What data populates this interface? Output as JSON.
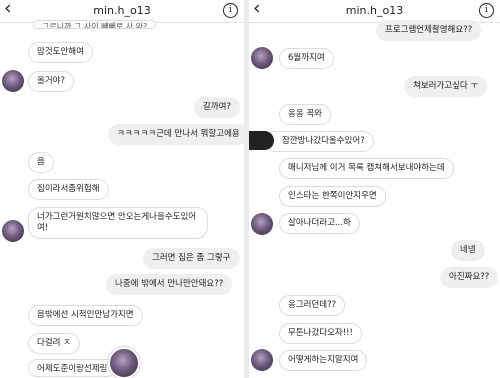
{
  "left": {
    "username": "min.h_o13",
    "messages": [
      {
        "text": "그르니까 그 사이 빼빼로 사 와?",
        "side": "received"
      },
      {
        "text": "맘것도안해여",
        "side": "received"
      },
      {
        "text": "올거야?",
        "side": "received"
      },
      {
        "text": "갈까여?",
        "side": "sent"
      },
      {
        "text": "ㅋㅋㅋㅋㅋ근데 만나서 뭐할고에용",
        "side": "sent"
      },
      {
        "text": "음",
        "side": "received"
      },
      {
        "text": "집이라서좀위험해",
        "side": "received"
      },
      {
        "text": "너가그런거원치않으면 안오는게나을수도있어여!",
        "side": "received"
      },
      {
        "text": "그러면 집은 좀 그렇구",
        "side": "sent"
      },
      {
        "text": "나중에 밖에서 만나만안돼요??",
        "side": "sent"
      },
      {
        "text": "음밖에선 시적인만남가지면",
        "side": "received"
      },
      {
        "text": "다걸려 ㅈ",
        "side": "received"
      },
      {
        "text": "어제도준이랑선제링",
        "side": "received"
      }
    ]
  },
  "right": {
    "username": "min.h_o13",
    "messages": [
      {
        "text": "프로그램언제촬영해요??",
        "side": "sent"
      },
      {
        "text": "6월까지여",
        "side": "received"
      },
      {
        "text": "쳐보러가고싶다 ㅜ",
        "side": "sent"
      },
      {
        "text": "옹옹 꼭와",
        "side": "received"
      },
      {
        "text": "잠깐방나갔다올수있어?",
        "side": "received"
      },
      {
        "text": "매니저님께 이거 목록 캡쳐해서보내야하는데",
        "side": "received"
      },
      {
        "text": "인스타는 한쪽이안지우면",
        "side": "received"
      },
      {
        "text": "살아나더라고...하",
        "side": "received"
      },
      {
        "text": "네넹",
        "side": "sent"
      },
      {
        "text": "아진짜요??",
        "side": "sent"
      },
      {
        "text": "옹그러던데??",
        "side": "received"
      },
      {
        "text": "무튼나갔다오자!!!",
        "side": "received"
      },
      {
        "text": "어떻게하는지알지여",
        "side": "received"
      }
    ]
  },
  "icons": {
    "back": "chevron-left-icon",
    "info": "info-icon",
    "back_glyph": "‹",
    "info_glyph": "i"
  }
}
